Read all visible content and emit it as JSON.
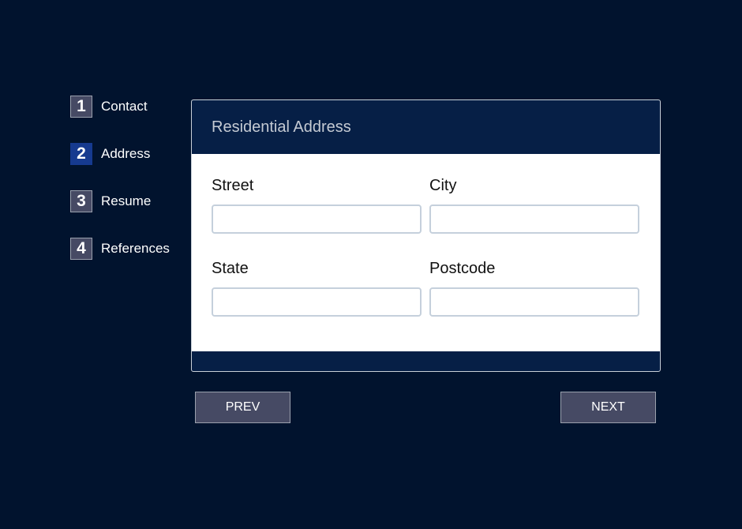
{
  "steps": [
    {
      "number": "1",
      "label": "Contact"
    },
    {
      "number": "2",
      "label": "Address"
    },
    {
      "number": "3",
      "label": "Resume"
    },
    {
      "number": "4",
      "label": "References"
    }
  ],
  "active_step": 2,
  "card": {
    "title": "Residential Address",
    "fields": [
      {
        "label": "Street",
        "value": "",
        "placeholder": ""
      },
      {
        "label": "City",
        "value": "",
        "placeholder": ""
      },
      {
        "label": "State",
        "value": "",
        "placeholder": ""
      },
      {
        "label": "Postcode",
        "value": "",
        "placeholder": ""
      }
    ]
  },
  "buttons": {
    "prev": "PREV",
    "next": "NEXT"
  },
  "colors": {
    "background": "#01132e",
    "header": "#061f46",
    "active_step": "#163a8f",
    "button": "#464a64"
  }
}
